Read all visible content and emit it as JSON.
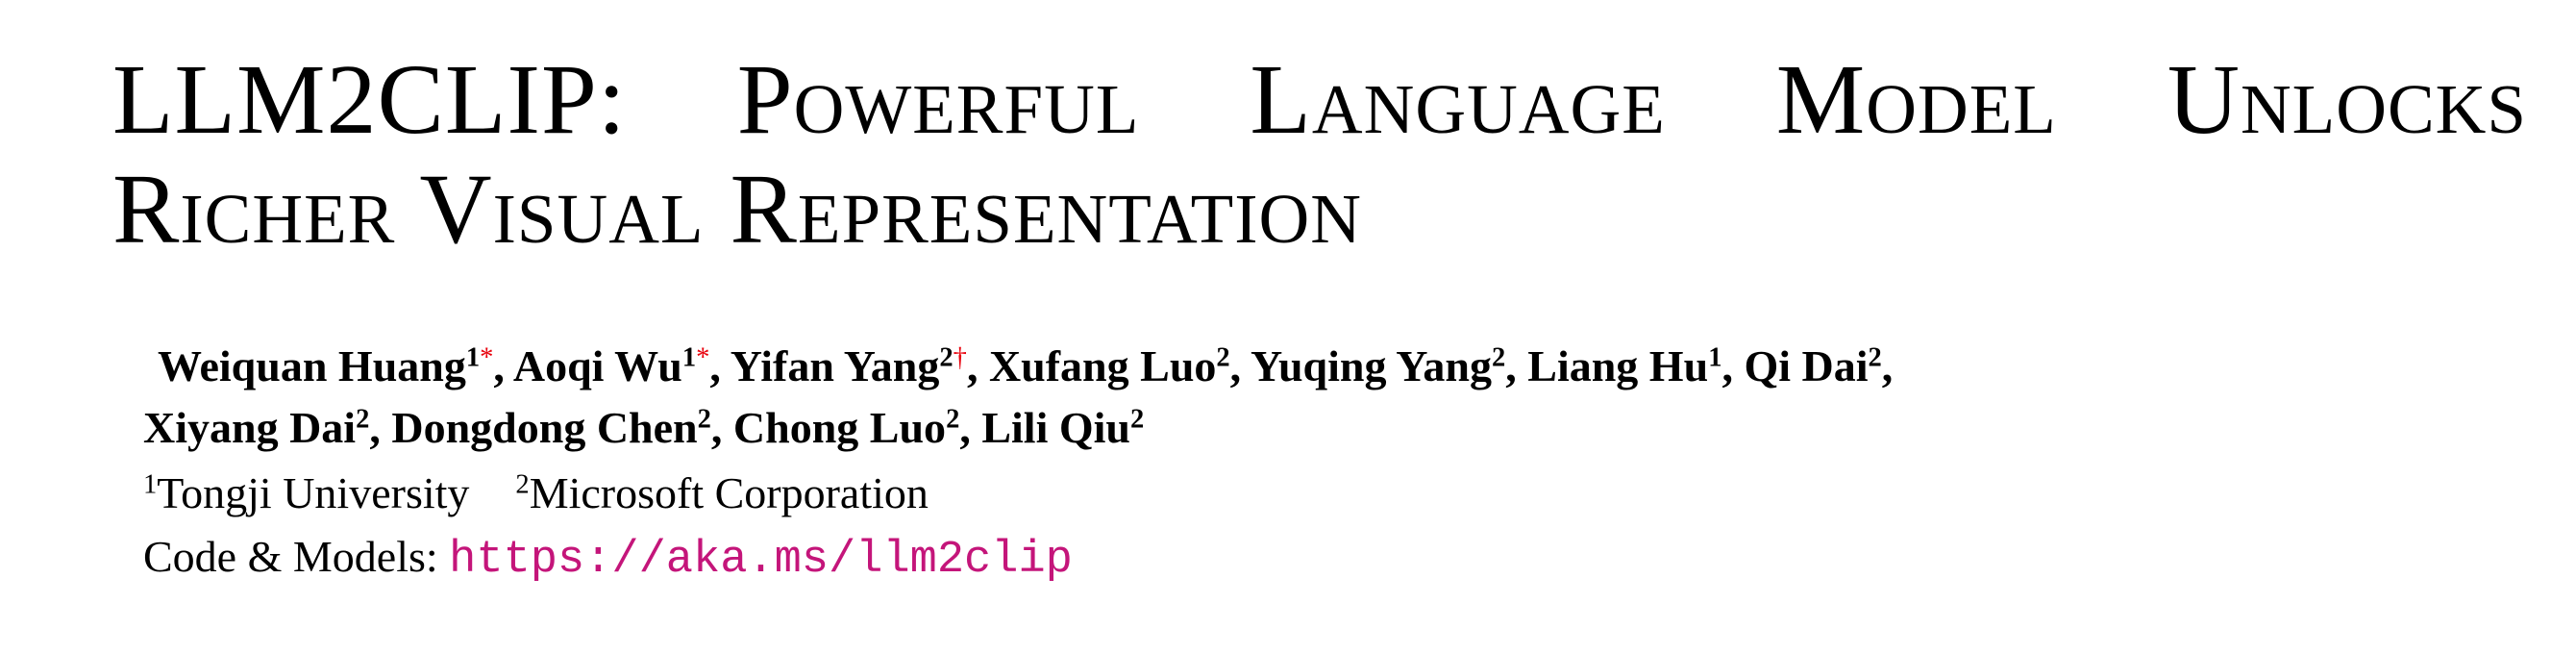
{
  "title": {
    "line1": "LLM2CLIP: Powerful Language Model Unlocks",
    "line2": "Richer Visual Representation"
  },
  "authors": [
    {
      "name": "Weiquan Huang",
      "aff": "1",
      "mark": "*"
    },
    {
      "name": "Aoqi Wu",
      "aff": "1",
      "mark": "*"
    },
    {
      "name": "Yifan Yang",
      "aff": "2",
      "mark": "†"
    },
    {
      "name": "Xufang Luo",
      "aff": "2"
    },
    {
      "name": "Yuqing Yang",
      "aff": "2"
    },
    {
      "name": "Liang Hu",
      "aff": "1"
    },
    {
      "name": "Qi Dai",
      "aff": "2"
    },
    {
      "name": "Xiyang Dai",
      "aff": "2"
    },
    {
      "name": "Dongdong Chen",
      "aff": "2"
    },
    {
      "name": "Chong Luo",
      "aff": "2"
    },
    {
      "name": "Lili Qiu",
      "aff": "2"
    }
  ],
  "affiliations": [
    {
      "num": "1",
      "name": "Tongji University"
    },
    {
      "num": "2",
      "name": "Microsoft Corporation"
    }
  ],
  "code": {
    "label": "Code & Models:",
    "url": "https://aka.ms/llm2clip"
  },
  "colors": {
    "mark": "#e8000b",
    "url": "#c4157a"
  }
}
